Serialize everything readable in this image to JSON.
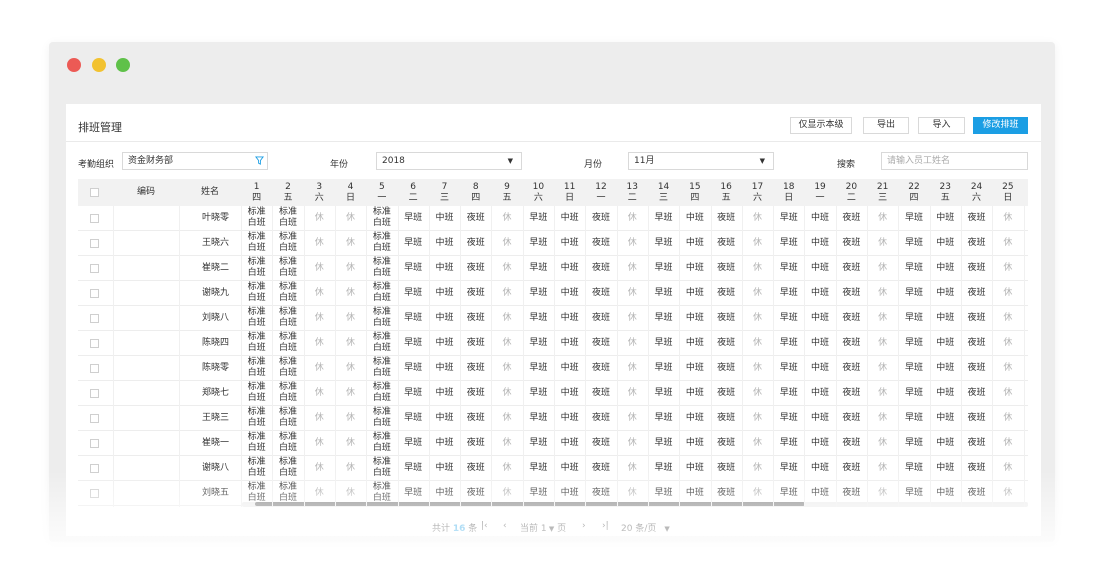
{
  "header": {
    "title": "排班管理",
    "buttons": [
      "仅显示本级",
      "导出",
      "导入",
      "修改排班"
    ]
  },
  "filters": {
    "org_label": "考勤组织",
    "org_value": "资金财务部",
    "year_label": "年份",
    "year_value": "2018",
    "month_label": "月份",
    "month_value": "11月",
    "search_label": "搜索",
    "search_placeholder": "请输入员工姓名"
  },
  "table": {
    "headers": {
      "code": "编码",
      "name": "姓名"
    },
    "days": [
      {
        "d": "1",
        "w": "四"
      },
      {
        "d": "2",
        "w": "五"
      },
      {
        "d": "3",
        "w": "六"
      },
      {
        "d": "4",
        "w": "日"
      },
      {
        "d": "5",
        "w": "一"
      },
      {
        "d": "6",
        "w": "二"
      },
      {
        "d": "7",
        "w": "三"
      },
      {
        "d": "8",
        "w": "四"
      },
      {
        "d": "9",
        "w": "五"
      },
      {
        "d": "10",
        "w": "六"
      },
      {
        "d": "11",
        "w": "日"
      },
      {
        "d": "12",
        "w": "一"
      },
      {
        "d": "13",
        "w": "二"
      },
      {
        "d": "14",
        "w": "三"
      },
      {
        "d": "15",
        "w": "四"
      },
      {
        "d": "16",
        "w": "五"
      },
      {
        "d": "17",
        "w": "六"
      },
      {
        "d": "18",
        "w": "日"
      },
      {
        "d": "19",
        "w": "一"
      },
      {
        "d": "20",
        "w": "二"
      },
      {
        "d": "21",
        "w": "三"
      },
      {
        "d": "22",
        "w": "四"
      },
      {
        "d": "23",
        "w": "五"
      },
      {
        "d": "24",
        "w": "六"
      },
      {
        "d": "25",
        "w": "日"
      }
    ],
    "shift_labels": {
      "std": "标准\n白班",
      "rest": "休",
      "early": "早班",
      "mid": "中班",
      "night": "夜班"
    },
    "pattern": [
      "std",
      "std",
      "rest",
      "rest",
      "std",
      "early",
      "mid",
      "night",
      "rest",
      "early",
      "mid",
      "night",
      "rest",
      "early",
      "mid",
      "night",
      "rest",
      "early",
      "mid",
      "night",
      "rest",
      "early",
      "mid",
      "night",
      "rest"
    ],
    "rows": [
      {
        "code": "",
        "name": "叶晓零"
      },
      {
        "code": "",
        "name": "王晓六"
      },
      {
        "code": "",
        "name": "崔晓二"
      },
      {
        "code": "",
        "name": "谢晓九"
      },
      {
        "code": "",
        "name": "刘晓八"
      },
      {
        "code": "",
        "name": "陈晓四"
      },
      {
        "code": "",
        "name": "陈晓零"
      },
      {
        "code": "",
        "name": "郑晓七"
      },
      {
        "code": "",
        "name": "王晓三"
      },
      {
        "code": "",
        "name": "崔晓一"
      },
      {
        "code": "",
        "name": "谢晓八"
      },
      {
        "code": "",
        "name": "刘晓五"
      }
    ]
  },
  "pagination": {
    "total_prefix": "共计",
    "total": "16",
    "total_suffix": "条",
    "current_label": "当前",
    "current_page": "1",
    "page_suffix": "页",
    "page_size": "20 条/页"
  }
}
